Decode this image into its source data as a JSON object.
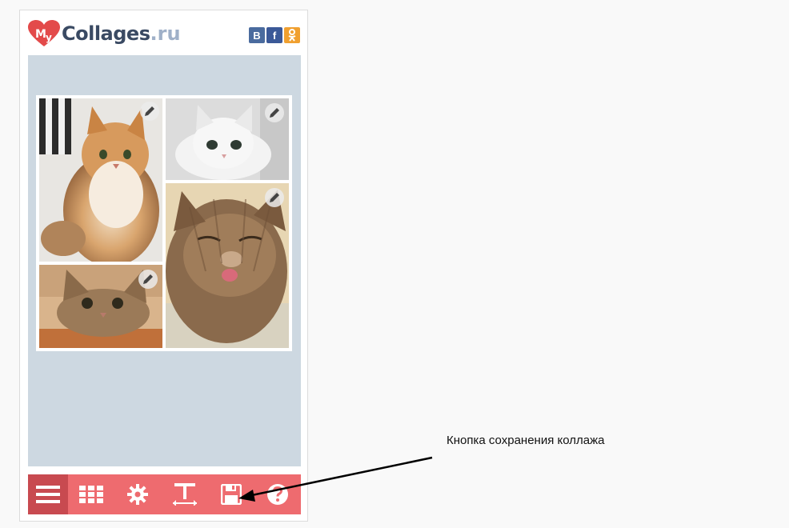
{
  "header": {
    "logo_text": "Collages",
    "logo_suffix": ".ru",
    "logo_mark": "My",
    "social": [
      {
        "label": "В",
        "icon": "vk-icon",
        "color": "#4a6b9e"
      },
      {
        "label": "f",
        "icon": "facebook-icon",
        "color": "#3b5998"
      },
      {
        "label": "ok",
        "icon": "odnoklassniki-icon",
        "color": "#f0a030"
      }
    ]
  },
  "canvas": {
    "background": "#cdd8e1",
    "photos": [
      {
        "subject": "fluffy ginger cat",
        "icon": "edit-pencil-icon"
      },
      {
        "subject": "white cat lying",
        "icon": "edit-pencil-icon"
      },
      {
        "subject": "tabby cat with tongue out",
        "icon": "edit-pencil-icon"
      },
      {
        "subject": "tabby cat peeking over table",
        "icon": "edit-pencil-icon"
      }
    ]
  },
  "toolbar": {
    "background": "#ee6b6f",
    "items": [
      {
        "icon": "hamburger-menu-icon"
      },
      {
        "icon": "grid-layout-icon"
      },
      {
        "icon": "gear-icon"
      },
      {
        "icon": "text-icon"
      },
      {
        "icon": "save-floppy-icon"
      },
      {
        "icon": "help-icon"
      }
    ]
  },
  "annotation": {
    "text": "Кнопка сохранения коллажа"
  }
}
